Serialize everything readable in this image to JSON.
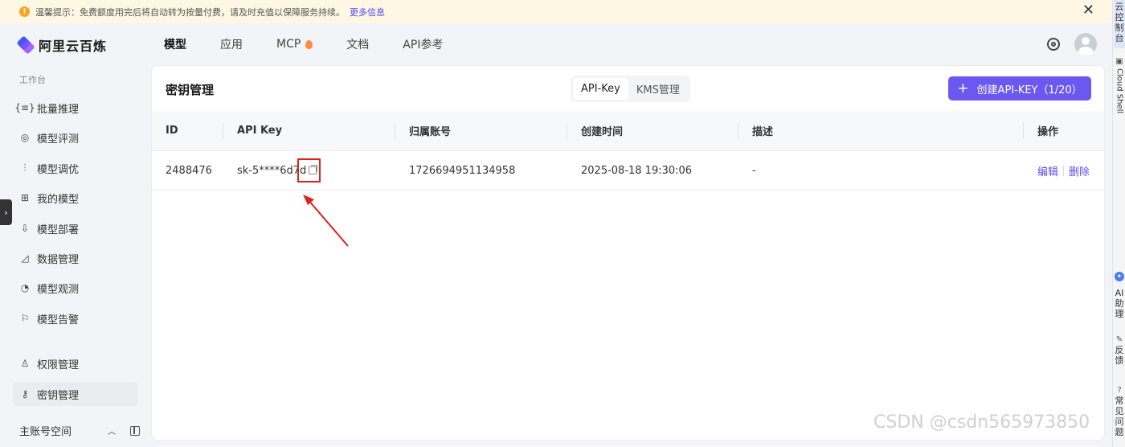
{
  "banner": {
    "text": "温馨提示：免费额度用完后将自动转为按量付费，请及时充值以保障服务持续。",
    "link": "更多信息",
    "close": "✕"
  },
  "logo": {
    "text": "阿里云百炼"
  },
  "nav": [
    {
      "label": "模型"
    },
    {
      "label": "应用"
    },
    {
      "label": "MCP"
    },
    {
      "label": "文档"
    },
    {
      "label": "API参考"
    }
  ],
  "sidebar": {
    "section": "工作台",
    "items": [
      {
        "label": "批量推理",
        "icon": "{≡}"
      },
      {
        "label": "模型评测",
        "icon": "◎"
      },
      {
        "label": "模型调优",
        "icon": "⫶"
      },
      {
        "label": "我的模型",
        "icon": "⊞"
      },
      {
        "label": "模型部署",
        "icon": "⇩"
      },
      {
        "label": "数据管理",
        "icon": "◿"
      },
      {
        "label": "模型观测",
        "icon": "◔"
      },
      {
        "label": "模型告警",
        "icon": "⚐"
      },
      {
        "label": "权限管理",
        "icon": "♙"
      },
      {
        "label": "密钥管理",
        "icon": "⚷"
      }
    ],
    "footer": "主账号空间"
  },
  "card": {
    "title": "密钥管理",
    "tabs": [
      {
        "label": "API-Key"
      },
      {
        "label": "KMS管理"
      }
    ],
    "create_button": "创建API-KEY（1/20）"
  },
  "table": {
    "headers": [
      "ID",
      "API Key",
      "归属账号",
      "创建时间",
      "描述",
      "操作"
    ],
    "rows": [
      {
        "id": "2488476",
        "api_key": "sk-5****6d7d",
        "account": "1726694951134958",
        "created": "2025-08-18 19:30:06",
        "desc": "-",
        "edit": "编辑",
        "delete": "删除"
      }
    ]
  },
  "right_rail": {
    "console": "云控制台",
    "cloud_shell": "Cloud Shell",
    "ai": "AI助理",
    "feedback": "反馈",
    "faq": "常见问题"
  },
  "watermark": "CSDN @csdn565973850"
}
